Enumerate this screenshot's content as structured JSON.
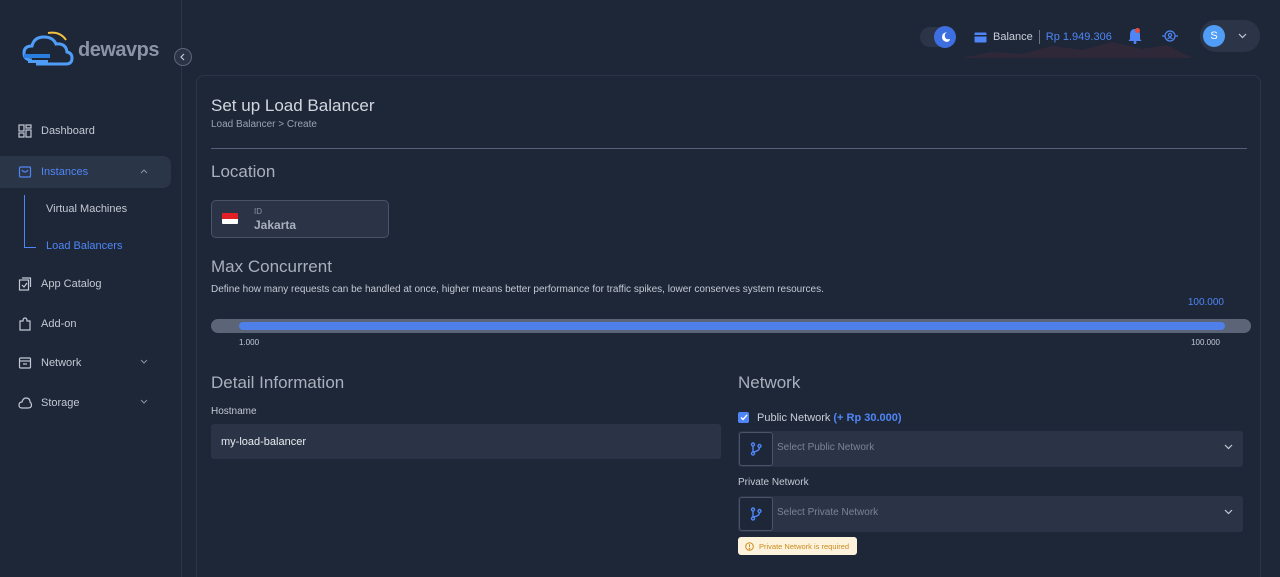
{
  "brand": {
    "name": "dewavps"
  },
  "sidebar": {
    "items": [
      {
        "label": "Dashboard"
      },
      {
        "label": "Instances"
      },
      {
        "label": "App Catalog"
      },
      {
        "label": "Add-on"
      },
      {
        "label": "Network"
      },
      {
        "label": "Storage"
      }
    ],
    "instances_sub": [
      {
        "label": "Virtual Machines"
      },
      {
        "label": "Load Balancers"
      }
    ]
  },
  "header": {
    "balance_label": "Balance",
    "balance_amount": "Rp 1.949.306",
    "avatar_initial": "S"
  },
  "page": {
    "title": "Set up Load Balancer",
    "breadcrumb": "Load Balancer > Create"
  },
  "location": {
    "section_title": "Location",
    "code": "ID",
    "name": "Jakarta"
  },
  "concurrent": {
    "section_title": "Max Concurrent",
    "description": "Define how many requests can be handled at once, higher means better performance for traffic spikes, lower conserves system resources.",
    "current_value": "100.000",
    "min_label": "1.000",
    "max_label": "100.000",
    "fill_fraction": 1.0
  },
  "detail": {
    "section_title": "Detail Information",
    "hostname_label": "Hostname",
    "hostname_value": "my-load-balancer"
  },
  "network": {
    "section_title": "Network",
    "public_label": "Public Network",
    "public_price": "(+ Rp 30.000)",
    "public_placeholder": "Select Public Network",
    "private_label": "Private Network",
    "private_placeholder": "Select Private Network",
    "private_error": "Private Network is required"
  },
  "colors": {
    "accent": "#4f86f7",
    "background": "#1e2738",
    "warning_bg": "#fdf3dd",
    "warning_text": "#c98b1e"
  }
}
